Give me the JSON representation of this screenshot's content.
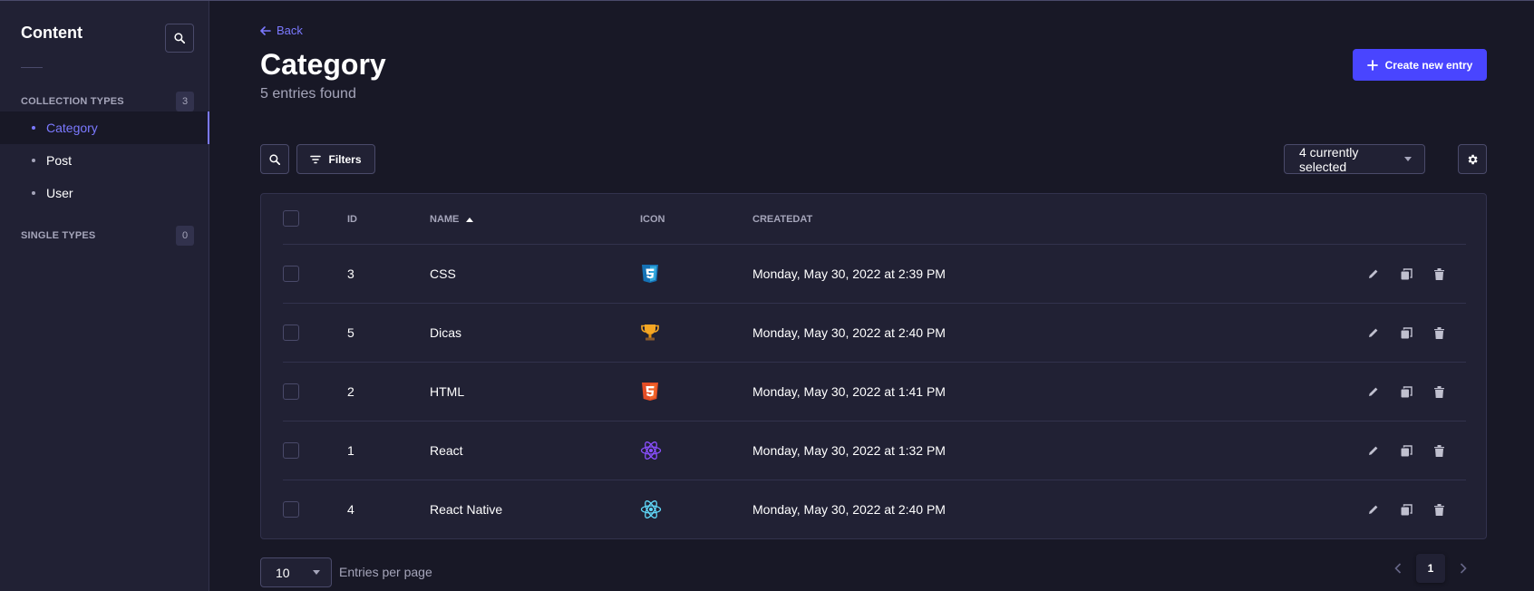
{
  "sidebar": {
    "title": "Content",
    "collection_types": {
      "label": "COLLECTION TYPES",
      "count": "3"
    },
    "items": [
      {
        "label": "Category",
        "active": true
      },
      {
        "label": "Post",
        "active": false
      },
      {
        "label": "User",
        "active": false
      }
    ],
    "single_types": {
      "label": "SINGLE TYPES",
      "count": "0"
    }
  },
  "header": {
    "back_label": "Back",
    "title": "Category",
    "subtitle": "5 entries found",
    "create_label": "Create new entry"
  },
  "toolbar": {
    "filters_label": "Filters",
    "columns_select": "4 currently selected"
  },
  "table": {
    "headers": {
      "id": "ID",
      "name": "NAME",
      "icon": "ICON",
      "created": "CREATEDAT"
    },
    "rows": [
      {
        "id": "3",
        "name": "CSS",
        "icon": "css3-icon",
        "created": "Monday, May 30, 2022 at 2:39 PM"
      },
      {
        "id": "5",
        "name": "Dicas",
        "icon": "trophy-icon",
        "created": "Monday, May 30, 2022 at 2:40 PM"
      },
      {
        "id": "2",
        "name": "HTML",
        "icon": "html5-icon",
        "created": "Monday, May 30, 2022 at 1:41 PM"
      },
      {
        "id": "1",
        "name": "React",
        "icon": "react-purple-icon",
        "created": "Monday, May 30, 2022 at 1:32 PM"
      },
      {
        "id": "4",
        "name": "React Native",
        "icon": "react-icon",
        "created": "Monday, May 30, 2022 at 2:40 PM"
      }
    ]
  },
  "footer": {
    "per_page": "10",
    "per_page_label": "Entries per page",
    "current_page": "1"
  },
  "colors": {
    "accent": "#7b79ff",
    "primary_button": "#4945ff",
    "background": "#181826",
    "surface": "#212134"
  }
}
